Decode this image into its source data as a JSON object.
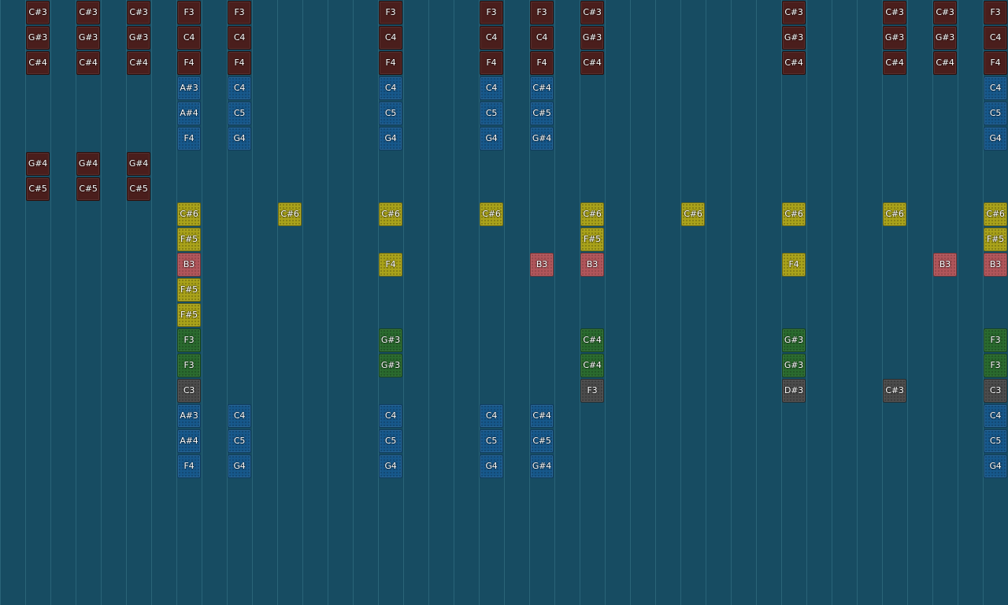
{
  "colors": {
    "background": "#174c62",
    "gridline": "#2a6478",
    "maroon": "#4a1e1c",
    "blue": "#17588b",
    "yellow": "#a9a21a",
    "pink": "#b0555a",
    "green": "#2a6a2e",
    "gray": "#4b4b4b"
  },
  "notes": [
    {
      "col": 1,
      "row": 0,
      "label": "C#3",
      "color": "maroon"
    },
    {
      "col": 1,
      "row": 1,
      "label": "G#3",
      "color": "maroon"
    },
    {
      "col": 1,
      "row": 2,
      "label": "C#4",
      "color": "maroon"
    },
    {
      "col": 1,
      "row": 6,
      "label": "G#4",
      "color": "maroon"
    },
    {
      "col": 1,
      "row": 7,
      "label": "C#5",
      "color": "maroon"
    },
    {
      "col": 3,
      "row": 0,
      "label": "C#3",
      "color": "maroon"
    },
    {
      "col": 3,
      "row": 1,
      "label": "G#3",
      "color": "maroon"
    },
    {
      "col": 3,
      "row": 2,
      "label": "C#4",
      "color": "maroon"
    },
    {
      "col": 3,
      "row": 6,
      "label": "G#4",
      "color": "maroon"
    },
    {
      "col": 3,
      "row": 7,
      "label": "C#5",
      "color": "maroon"
    },
    {
      "col": 5,
      "row": 0,
      "label": "C#3",
      "color": "maroon"
    },
    {
      "col": 5,
      "row": 1,
      "label": "G#3",
      "color": "maroon"
    },
    {
      "col": 5,
      "row": 2,
      "label": "C#4",
      "color": "maroon"
    },
    {
      "col": 5,
      "row": 6,
      "label": "G#4",
      "color": "maroon"
    },
    {
      "col": 5,
      "row": 7,
      "label": "C#5",
      "color": "maroon"
    },
    {
      "col": 7,
      "row": 0,
      "label": "F3",
      "color": "maroon"
    },
    {
      "col": 7,
      "row": 1,
      "label": "C4",
      "color": "maroon"
    },
    {
      "col": 7,
      "row": 2,
      "label": "F4",
      "color": "maroon"
    },
    {
      "col": 7,
      "row": 3,
      "label": "A#3",
      "color": "blue"
    },
    {
      "col": 7,
      "row": 4,
      "label": "A#4",
      "color": "blue"
    },
    {
      "col": 7,
      "row": 5,
      "label": "F4",
      "color": "blue"
    },
    {
      "col": 7,
      "row": 8,
      "label": "C#6",
      "color": "yellow"
    },
    {
      "col": 7,
      "row": 9,
      "label": "F#5",
      "color": "yellow"
    },
    {
      "col": 7,
      "row": 10,
      "label": "B3",
      "color": "pink"
    },
    {
      "col": 7,
      "row": 11,
      "label": "F#5",
      "color": "yellow"
    },
    {
      "col": 7,
      "row": 12,
      "label": "F#5",
      "color": "yellow"
    },
    {
      "col": 7,
      "row": 13,
      "label": "F3",
      "color": "green"
    },
    {
      "col": 7,
      "row": 14,
      "label": "F3",
      "color": "green"
    },
    {
      "col": 7,
      "row": 15,
      "label": "C3",
      "color": "gray"
    },
    {
      "col": 7,
      "row": 16,
      "label": "A#3",
      "color": "blue"
    },
    {
      "col": 7,
      "row": 17,
      "label": "A#4",
      "color": "blue"
    },
    {
      "col": 7,
      "row": 18,
      "label": "F4",
      "color": "blue"
    },
    {
      "col": 9,
      "row": 0,
      "label": "F3",
      "color": "maroon"
    },
    {
      "col": 9,
      "row": 1,
      "label": "C4",
      "color": "maroon"
    },
    {
      "col": 9,
      "row": 2,
      "label": "F4",
      "color": "maroon"
    },
    {
      "col": 9,
      "row": 3,
      "label": "C4",
      "color": "blue"
    },
    {
      "col": 9,
      "row": 4,
      "label": "C5",
      "color": "blue"
    },
    {
      "col": 9,
      "row": 5,
      "label": "G4",
      "color": "blue"
    },
    {
      "col": 9,
      "row": 16,
      "label": "C4",
      "color": "blue"
    },
    {
      "col": 9,
      "row": 17,
      "label": "C5",
      "color": "blue"
    },
    {
      "col": 9,
      "row": 18,
      "label": "G4",
      "color": "blue"
    },
    {
      "col": 11,
      "row": 8,
      "label": "C#6",
      "color": "yellow"
    },
    {
      "col": 15,
      "row": 0,
      "label": "F3",
      "color": "maroon"
    },
    {
      "col": 15,
      "row": 1,
      "label": "C4",
      "color": "maroon"
    },
    {
      "col": 15,
      "row": 2,
      "label": "F4",
      "color": "maroon"
    },
    {
      "col": 15,
      "row": 3,
      "label": "C4",
      "color": "blue"
    },
    {
      "col": 15,
      "row": 4,
      "label": "C5",
      "color": "blue"
    },
    {
      "col": 15,
      "row": 5,
      "label": "G4",
      "color": "blue"
    },
    {
      "col": 15,
      "row": 8,
      "label": "C#6",
      "color": "yellow"
    },
    {
      "col": 15,
      "row": 10,
      "label": "F4",
      "color": "yellow"
    },
    {
      "col": 15,
      "row": 13,
      "label": "G#3",
      "color": "green"
    },
    {
      "col": 15,
      "row": 14,
      "label": "G#3",
      "color": "green"
    },
    {
      "col": 15,
      "row": 16,
      "label": "C4",
      "color": "blue"
    },
    {
      "col": 15,
      "row": 17,
      "label": "C5",
      "color": "blue"
    },
    {
      "col": 15,
      "row": 18,
      "label": "G4",
      "color": "blue"
    },
    {
      "col": 19,
      "row": 0,
      "label": "F3",
      "color": "maroon"
    },
    {
      "col": 19,
      "row": 1,
      "label": "C4",
      "color": "maroon"
    },
    {
      "col": 19,
      "row": 2,
      "label": "F4",
      "color": "maroon"
    },
    {
      "col": 19,
      "row": 3,
      "label": "C4",
      "color": "blue"
    },
    {
      "col": 19,
      "row": 4,
      "label": "C5",
      "color": "blue"
    },
    {
      "col": 19,
      "row": 5,
      "label": "G4",
      "color": "blue"
    },
    {
      "col": 19,
      "row": 8,
      "label": "C#6",
      "color": "yellow"
    },
    {
      "col": 19,
      "row": 16,
      "label": "C4",
      "color": "blue"
    },
    {
      "col": 19,
      "row": 17,
      "label": "C5",
      "color": "blue"
    },
    {
      "col": 19,
      "row": 18,
      "label": "G4",
      "color": "blue"
    },
    {
      "col": 21,
      "row": 0,
      "label": "F3",
      "color": "maroon"
    },
    {
      "col": 21,
      "row": 1,
      "label": "C4",
      "color": "maroon"
    },
    {
      "col": 21,
      "row": 2,
      "label": "F4",
      "color": "maroon"
    },
    {
      "col": 21,
      "row": 3,
      "label": "C#4",
      "color": "blue"
    },
    {
      "col": 21,
      "row": 4,
      "label": "C#5",
      "color": "blue"
    },
    {
      "col": 21,
      "row": 5,
      "label": "G#4",
      "color": "blue"
    },
    {
      "col": 21,
      "row": 10,
      "label": "B3",
      "color": "pink"
    },
    {
      "col": 21,
      "row": 16,
      "label": "C#4",
      "color": "blue"
    },
    {
      "col": 21,
      "row": 17,
      "label": "C#5",
      "color": "blue"
    },
    {
      "col": 21,
      "row": 18,
      "label": "G#4",
      "color": "blue"
    },
    {
      "col": 23,
      "row": 0,
      "label": "C#3",
      "color": "maroon"
    },
    {
      "col": 23,
      "row": 1,
      "label": "G#3",
      "color": "maroon"
    },
    {
      "col": 23,
      "row": 2,
      "label": "C#4",
      "color": "maroon"
    },
    {
      "col": 23,
      "row": 8,
      "label": "C#6",
      "color": "yellow"
    },
    {
      "col": 23,
      "row": 9,
      "label": "F#5",
      "color": "yellow"
    },
    {
      "col": 23,
      "row": 10,
      "label": "B3",
      "color": "pink"
    },
    {
      "col": 23,
      "row": 13,
      "label": "C#4",
      "color": "green"
    },
    {
      "col": 23,
      "row": 14,
      "label": "C#4",
      "color": "green"
    },
    {
      "col": 23,
      "row": 15,
      "label": "F3",
      "color": "gray"
    },
    {
      "col": 27,
      "row": 8,
      "label": "C#6",
      "color": "yellow"
    },
    {
      "col": 31,
      "row": 0,
      "label": "C#3",
      "color": "maroon"
    },
    {
      "col": 31,
      "row": 1,
      "label": "G#3",
      "color": "maroon"
    },
    {
      "col": 31,
      "row": 2,
      "label": "C#4",
      "color": "maroon"
    },
    {
      "col": 31,
      "row": 8,
      "label": "C#6",
      "color": "yellow"
    },
    {
      "col": 31,
      "row": 10,
      "label": "F4",
      "color": "yellow"
    },
    {
      "col": 31,
      "row": 13,
      "label": "G#3",
      "color": "green"
    },
    {
      "col": 31,
      "row": 14,
      "label": "G#3",
      "color": "green"
    },
    {
      "col": 31,
      "row": 15,
      "label": "D#3",
      "color": "gray"
    },
    {
      "col": 35,
      "row": 0,
      "label": "C#3",
      "color": "maroon"
    },
    {
      "col": 35,
      "row": 1,
      "label": "G#3",
      "color": "maroon"
    },
    {
      "col": 35,
      "row": 2,
      "label": "C#4",
      "color": "maroon"
    },
    {
      "col": 35,
      "row": 8,
      "label": "C#6",
      "color": "yellow"
    },
    {
      "col": 35,
      "row": 15,
      "label": "C#3",
      "color": "gray"
    },
    {
      "col": 37,
      "row": 0,
      "label": "C#3",
      "color": "maroon"
    },
    {
      "col": 37,
      "row": 1,
      "label": "G#3",
      "color": "maroon"
    },
    {
      "col": 37,
      "row": 2,
      "label": "C#4",
      "color": "maroon"
    },
    {
      "col": 37,
      "row": 10,
      "label": "B3",
      "color": "pink"
    },
    {
      "col": 39,
      "row": 0,
      "label": "F3",
      "color": "maroon"
    },
    {
      "col": 39,
      "row": 1,
      "label": "C4",
      "color": "maroon"
    },
    {
      "col": 39,
      "row": 2,
      "label": "F4",
      "color": "maroon"
    },
    {
      "col": 39,
      "row": 3,
      "label": "C4",
      "color": "blue"
    },
    {
      "col": 39,
      "row": 4,
      "label": "C5",
      "color": "blue"
    },
    {
      "col": 39,
      "row": 5,
      "label": "G4",
      "color": "blue"
    },
    {
      "col": 39,
      "row": 8,
      "label": "C#6",
      "color": "yellow"
    },
    {
      "col": 39,
      "row": 9,
      "label": "F#5",
      "color": "yellow"
    },
    {
      "col": 39,
      "row": 10,
      "label": "B3",
      "color": "pink"
    },
    {
      "col": 39,
      "row": 13,
      "label": "F3",
      "color": "green"
    },
    {
      "col": 39,
      "row": 14,
      "label": "F3",
      "color": "green"
    },
    {
      "col": 39,
      "row": 15,
      "label": "C3",
      "color": "gray"
    },
    {
      "col": 39,
      "row": 16,
      "label": "C4",
      "color": "blue"
    },
    {
      "col": 39,
      "row": 17,
      "label": "C5",
      "color": "blue"
    },
    {
      "col": 39,
      "row": 18,
      "label": "G4",
      "color": "blue"
    }
  ]
}
